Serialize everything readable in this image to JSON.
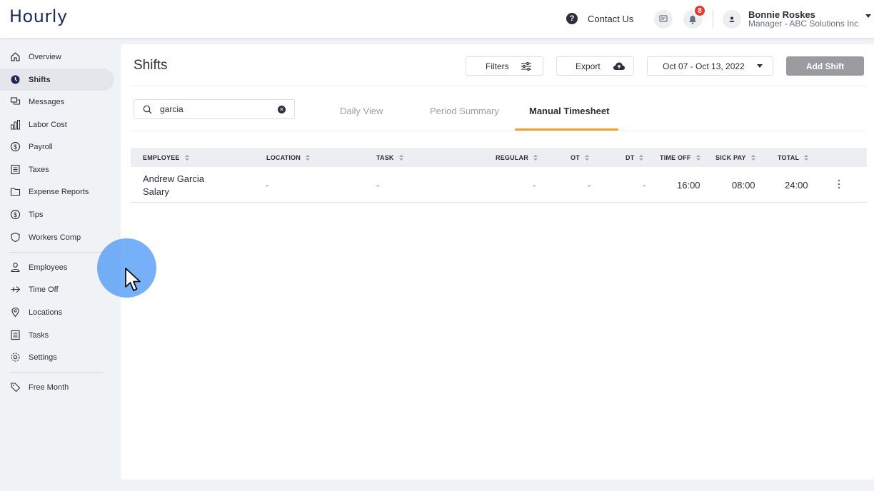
{
  "app": {
    "logo": "Hourly"
  },
  "header": {
    "contact": "Contact Us",
    "contact_icon": "?",
    "notification_count": "8",
    "user_name": "Bonnie Roskes",
    "user_role": "Manager - ABC Solutions Inc"
  },
  "sidebar": {
    "items": [
      {
        "label": "Overview",
        "icon": "home-icon"
      },
      {
        "label": "Shifts",
        "icon": "clock-icon",
        "active": true
      },
      {
        "label": "Messages",
        "icon": "messages-icon"
      },
      {
        "label": "Labor Cost",
        "icon": "bar-chart-icon"
      },
      {
        "label": "Payroll",
        "icon": "dollar-icon"
      },
      {
        "label": "Taxes",
        "icon": "document-icon"
      },
      {
        "label": "Expense Reports",
        "icon": "folder-icon"
      },
      {
        "label": "Tips",
        "icon": "dollar-icon"
      },
      {
        "label": "Workers Comp",
        "icon": "shield-icon"
      },
      {
        "label": "Employees",
        "icon": "person-icon"
      },
      {
        "label": "Time Off",
        "icon": "plane-icon"
      },
      {
        "label": "Locations",
        "icon": "pin-icon"
      },
      {
        "label": "Tasks",
        "icon": "list-icon"
      },
      {
        "label": "Settings",
        "icon": "gear-icon"
      },
      {
        "label": "Free Month",
        "icon": "tag-icon"
      }
    ]
  },
  "main": {
    "title": "Shifts",
    "filters_label": "Filters",
    "export_label": "Export",
    "date_range": "Oct 07 - Oct 13, 2022",
    "add_shift_label": "Add Shift",
    "search_value": "garcia",
    "tabs": [
      {
        "label": "Daily View"
      },
      {
        "label": "Period Summary"
      },
      {
        "label": "Manual Timesheet",
        "active": true
      }
    ],
    "table": {
      "columns": [
        "EMPLOYEE",
        "LOCATION",
        "TASK",
        "REGULAR",
        "OT",
        "DT",
        "TIME OFF",
        "SICK PAY",
        "TOTAL"
      ],
      "rows": [
        {
          "employee": "Andrew Garcia",
          "employee_type": "Salary",
          "location": "-",
          "task": "-",
          "regular": "-",
          "ot": "-",
          "dt": "-",
          "time_off": "16:00",
          "sick_pay": "08:00",
          "total": "24:00"
        }
      ]
    }
  },
  "colors": {
    "accent": "#f0a229",
    "brand": "#1e2a5a",
    "badge": "#e5392f",
    "cursor_halo": "#4896f5"
  }
}
